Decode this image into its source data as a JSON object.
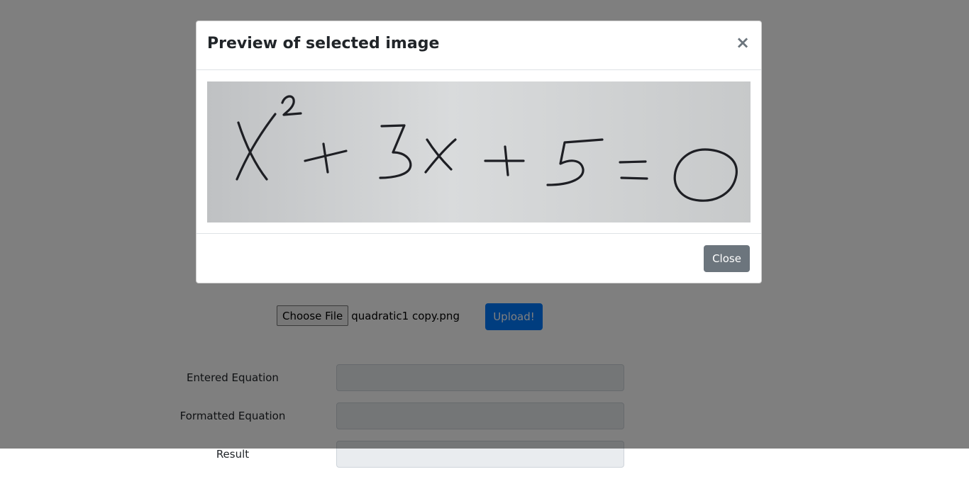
{
  "upload": {
    "choose_file_label": "Choose File",
    "file_name": "quadratic1 copy.png",
    "upload_label": "Upload!"
  },
  "form": {
    "entered_label": "Entered Equation",
    "formatted_label": "Formatted Equation",
    "result_label": "Result",
    "entered_value": "",
    "formatted_value": "",
    "result_value": ""
  },
  "modal": {
    "title": "Preview of selected image",
    "close_icon": "×",
    "close_label": "Close",
    "image_label": "X² + 3x + 5 = 0"
  },
  "colors": {
    "primary": "#007bff",
    "secondary": "#6c757d",
    "backdrop": "#808080"
  }
}
